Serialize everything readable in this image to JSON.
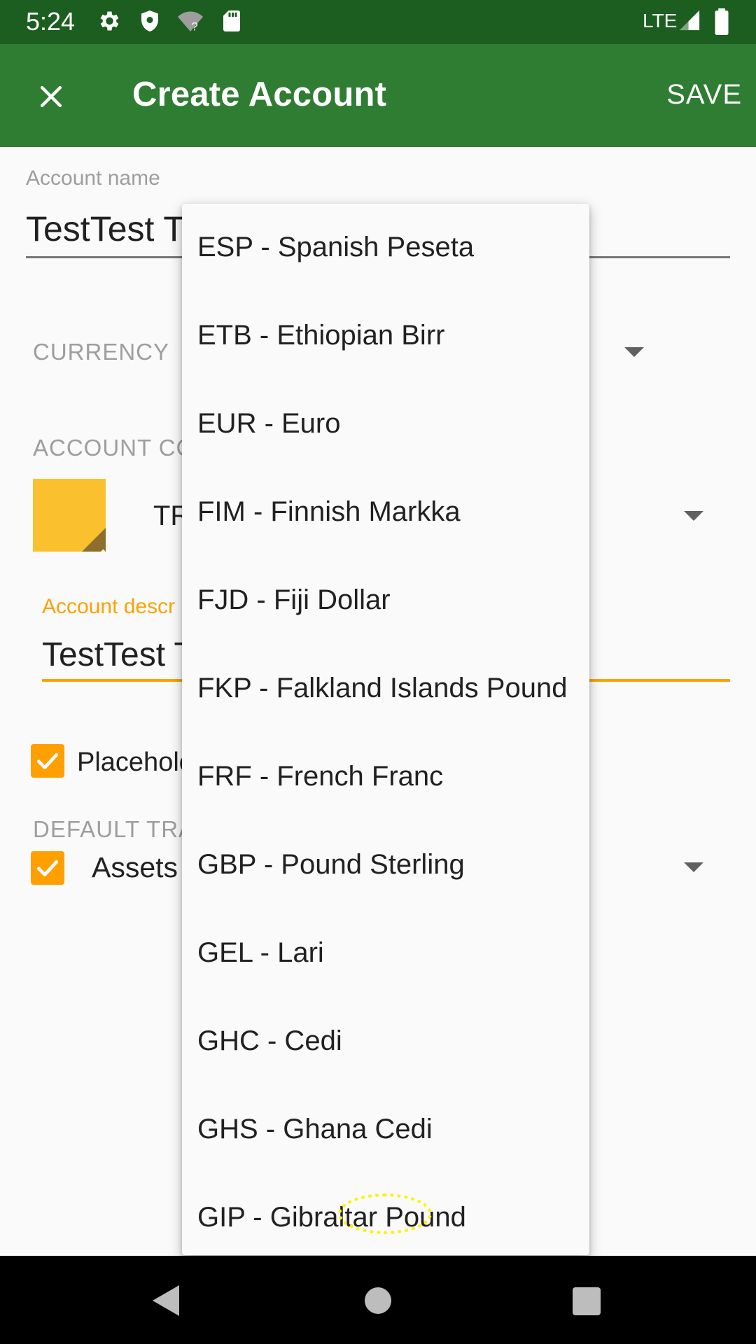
{
  "status_bar": {
    "time": "5:24",
    "network": "LTE",
    "icons": [
      "gear-icon",
      "shield-icon",
      "wifi-question-icon",
      "sd-card-icon",
      "signal-icon",
      "battery-icon"
    ]
  },
  "toolbar": {
    "title": "Create Account",
    "save_label": "SAVE",
    "close_icon": "close-icon"
  },
  "form": {
    "account_name_label": "Account name",
    "account_name_value": "TestTest T",
    "currency_label": "CURRENCY",
    "account_color_label": "ACCOUNT CO",
    "account_type_value": "TR",
    "description_label": "Account descr",
    "description_value": "TestTest T",
    "placeholder_label": "Placeholo",
    "placeholder_checked": true,
    "default_transfer_label": "DEFAULT TRA",
    "default_transfer_value": "Assets",
    "default_transfer_checked": true,
    "accent_color": "#FFA000",
    "swatch_color": "#FBC02D"
  },
  "currency_dropdown": {
    "items": [
      "ESP - Spanish Peseta",
      "ETB - Ethiopian Birr",
      "EUR - Euro",
      "FIM - Finnish Markka",
      "FJD - Fiji Dollar",
      "FKP - Falkland Islands Pound",
      "FRF - French Franc",
      "GBP - Pound Sterling",
      "GEL - Lari",
      "GHC - Cedi",
      "GHS - Ghana Cedi",
      "GIP - Gibraltar Pound"
    ]
  },
  "colors": {
    "status_bar": "#1B5E20",
    "toolbar": "#2E7D32",
    "accent": "#FFA000"
  }
}
